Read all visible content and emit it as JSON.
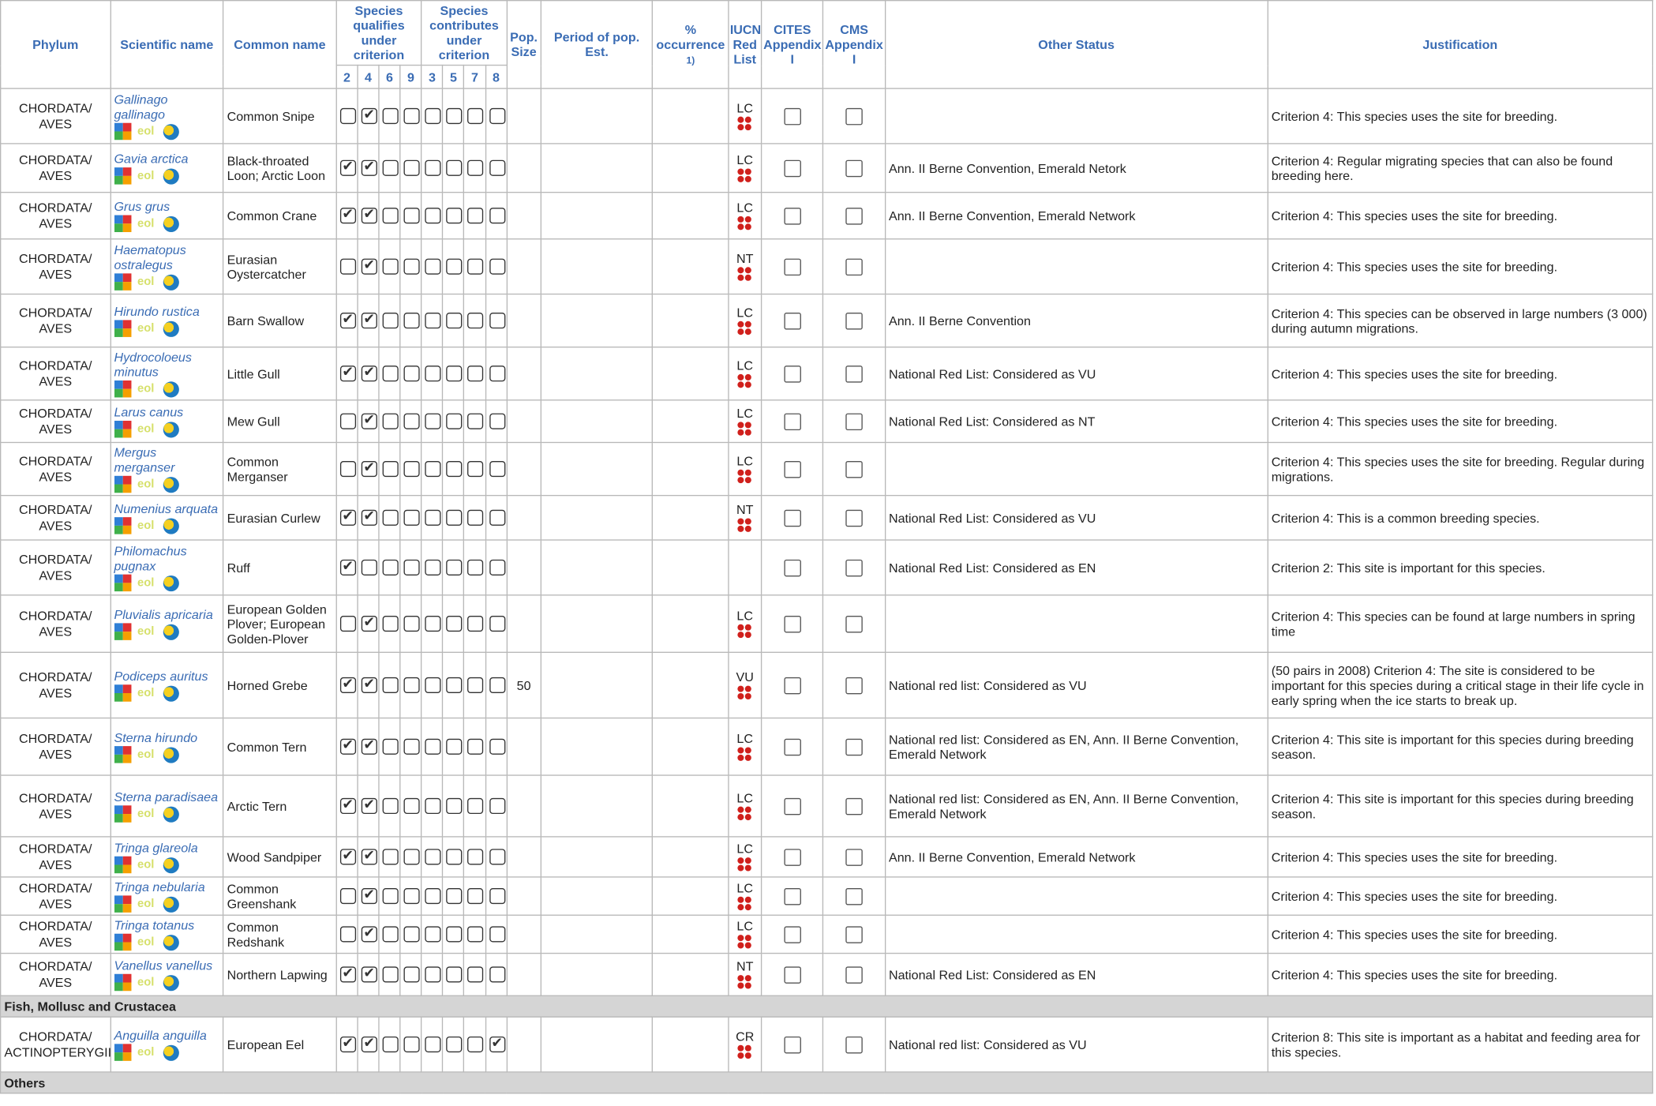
{
  "headers": {
    "phylum": "Phylum",
    "scientific": "Scientific name",
    "common": "Common name",
    "qualifies": "Species qualifies under criterion",
    "contributes": "Species contributes under criterion",
    "pop_size": "Pop. Size",
    "period": "Period of pop. Est.",
    "occurrence": "% occurrence",
    "occurrence_sup": "1)",
    "iucn": "IUCN Red List",
    "cites": "CITES Appendix I",
    "cms": "CMS Appendix I",
    "other_status": "Other Status",
    "justification": "Justification",
    "q_nums": [
      "2",
      "4",
      "6",
      "9"
    ],
    "c_nums": [
      "3",
      "5",
      "7",
      "8"
    ]
  },
  "rows": [
    {
      "phylum": "CHORDATA/ AVES",
      "sci": "Gallinago gallinago",
      "common": "Common Snipe",
      "checks": [
        0,
        1,
        0,
        0,
        0,
        0,
        0,
        0
      ],
      "pop": "",
      "iucn": "LC",
      "other": "",
      "just": "Criterion 4: This species uses the site for breeding.",
      "h": 52
    },
    {
      "phylum": "CHORDATA/ AVES",
      "sci": "Gavia arctica",
      "common": "Black-throated Loon; Arctic Loon",
      "checks": [
        1,
        1,
        0,
        0,
        0,
        0,
        0,
        0
      ],
      "pop": "",
      "iucn": "LC",
      "other": "Ann. II Berne Convention, Emerald Netork",
      "just": "Criterion 4: Regular migrating species that can also be found breeding here.",
      "h": 46
    },
    {
      "phylum": "CHORDATA/ AVES",
      "sci": "Grus grus",
      "common": "Common Crane",
      "checks": [
        1,
        1,
        0,
        0,
        0,
        0,
        0,
        0
      ],
      "pop": "",
      "iucn": "LC",
      "other": "Ann. II Berne Convention, Emerald Network",
      "just": "Criterion 4: This species uses the site for breeding.",
      "h": 44
    },
    {
      "phylum": "CHORDATA/ AVES",
      "sci": "Haematopus ostralegus",
      "common": "Eurasian Oystercatcher",
      "checks": [
        0,
        1,
        0,
        0,
        0,
        0,
        0,
        0
      ],
      "pop": "",
      "iucn": "NT",
      "other": "",
      "just": "Criterion 4: This species uses the site for breeding.",
      "h": 52
    },
    {
      "phylum": "CHORDATA/ AVES",
      "sci": "Hirundo rustica",
      "common": "Barn Swallow",
      "checks": [
        1,
        1,
        0,
        0,
        0,
        0,
        0,
        0
      ],
      "pop": "",
      "iucn": "LC",
      "other": "Ann. II Berne Convention",
      "just": "Criterion 4: This species can be observed in large numbers (3 000) during autumn migrations.",
      "h": 50
    },
    {
      "phylum": "CHORDATA/ AVES",
      "sci": "Hydrocoloeus minutus",
      "common": "Little Gull",
      "checks": [
        1,
        1,
        0,
        0,
        0,
        0,
        0,
        0
      ],
      "pop": "",
      "iucn": "LC",
      "other": "National Red List: Considered as VU",
      "just": "Criterion 4: This species uses the site for breeding.",
      "h": 50
    },
    {
      "phylum": "CHORDATA/ AVES",
      "sci": "Larus canus",
      "common": "Mew Gull",
      "checks": [
        0,
        1,
        0,
        0,
        0,
        0,
        0,
        0
      ],
      "pop": "",
      "iucn": "LC",
      "other": "National Red List: Considered as NT",
      "just": "Criterion 4: This species uses the site for breeding.",
      "h": 40
    },
    {
      "phylum": "CHORDATA/ AVES",
      "sci": "Mergus merganser",
      "common": "Common Merganser",
      "checks": [
        0,
        1,
        0,
        0,
        0,
        0,
        0,
        0
      ],
      "pop": "",
      "iucn": "LC",
      "other": "",
      "just": "Criterion 4: This species uses the site for breeding. Regular during migrations.",
      "h": 50
    },
    {
      "phylum": "CHORDATA/ AVES",
      "sci": "Numenius arquata",
      "common": "Eurasian Curlew",
      "checks": [
        1,
        1,
        0,
        0,
        0,
        0,
        0,
        0
      ],
      "pop": "",
      "iucn": "NT",
      "other": "National Red List: Considered as VU",
      "just": "Criterion 4: This is a common breeding species.",
      "h": 42
    },
    {
      "phylum": "CHORDATA/ AVES",
      "sci": "Philomachus pugnax",
      "common": "Ruff",
      "checks": [
        1,
        0,
        0,
        0,
        0,
        0,
        0,
        0
      ],
      "pop": "",
      "iucn": "",
      "other": "National Red List: Considered as EN",
      "just": "Criterion 2: This site is important for this species.",
      "h": 52
    },
    {
      "phylum": "CHORDATA/ AVES",
      "sci": "Pluvialis apricaria",
      "common": "European Golden Plover; European Golden-Plover",
      "checks": [
        0,
        1,
        0,
        0,
        0,
        0,
        0,
        0
      ],
      "pop": "",
      "iucn": "LC",
      "other": "",
      "just": "Criterion 4: This species can be found at large numbers in spring time",
      "h": 54
    },
    {
      "phylum": "CHORDATA/ AVES",
      "sci": "Podiceps auritus",
      "common": "Horned Grebe",
      "checks": [
        1,
        1,
        0,
        0,
        0,
        0,
        0,
        0
      ],
      "pop": "50",
      "iucn": "VU",
      "other": "National red list: Considered as VU",
      "just": "(50 pairs in 2008) Criterion 4: The site is considered to be important for this species during a critical stage in their life cycle in early spring when the ice starts to break up.",
      "h": 62
    },
    {
      "phylum": "CHORDATA/ AVES",
      "sci": "Sterna hirundo",
      "common": "Common Tern",
      "checks": [
        1,
        1,
        0,
        0,
        0,
        0,
        0,
        0
      ],
      "pop": "",
      "iucn": "LC",
      "other": "National red list: Considered as EN, Ann. II Berne Convention, Emerald Network",
      "just": "Criterion 4: This site is important for this species during breeding season.",
      "h": 54
    },
    {
      "phylum": "CHORDATA/ AVES",
      "sci": "Sterna paradisaea",
      "common": "Arctic Tern",
      "checks": [
        1,
        1,
        0,
        0,
        0,
        0,
        0,
        0
      ],
      "pop": "",
      "iucn": "LC",
      "other": "National red list: Considered as EN, Ann. II Berne Convention, Emerald Network",
      "just": "Criterion 4: This site is important for this species during breeding season.",
      "h": 58
    },
    {
      "phylum": "CHORDATA/ AVES",
      "sci": "Tringa glareola",
      "common": "Wood Sandpiper",
      "checks": [
        1,
        1,
        0,
        0,
        0,
        0,
        0,
        0
      ],
      "pop": "",
      "iucn": "LC",
      "other": "Ann. II Berne Convention, Emerald Network",
      "just": "Criterion 4: This species uses the site for breeding.",
      "h": 38
    },
    {
      "phylum": "CHORDATA/ AVES",
      "sci": "Tringa nebularia",
      "common": "Common Greenshank",
      "checks": [
        0,
        1,
        0,
        0,
        0,
        0,
        0,
        0
      ],
      "pop": "",
      "iucn": "LC",
      "other": "",
      "just": "Criterion 4: This species uses the site for breeding.",
      "h": 36
    },
    {
      "phylum": "CHORDATA/ AVES",
      "sci": "Tringa totanus",
      "common": "Common Redshank",
      "checks": [
        0,
        1,
        0,
        0,
        0,
        0,
        0,
        0
      ],
      "pop": "",
      "iucn": "LC",
      "other": "",
      "just": "Criterion 4: This species uses the site for breeding.",
      "h": 36
    },
    {
      "phylum": "CHORDATA/ AVES",
      "sci": "Vanellus vanellus",
      "common": "Northern Lapwing",
      "checks": [
        1,
        1,
        0,
        0,
        0,
        0,
        0,
        0
      ],
      "pop": "",
      "iucn": "NT",
      "other": "National Red List: Considered as EN",
      "just": "Criterion 4: This species uses the site for breeding.",
      "h": 40
    }
  ],
  "section_fish": "Fish, Mollusc and Crustacea",
  "fish_rows": [
    {
      "phylum": "CHORDATA/ ACTINOPTERYGII",
      "sci": "Anguilla anguilla",
      "common": "European Eel",
      "checks": [
        1,
        1,
        0,
        0,
        0,
        0,
        0,
        1
      ],
      "pop": "",
      "iucn": "CR",
      "other": "National red list: Considered as VU",
      "just": "Criterion 8: This site is important as a habitat and feeding area for this species.",
      "h": 52
    }
  ],
  "section_others": "Others",
  "icon_names": [
    "gbif-icon",
    "eol-icon",
    "iucn-globe-icon"
  ],
  "accent_color": "#3a6cb4",
  "section_color": "#d5d5d5"
}
